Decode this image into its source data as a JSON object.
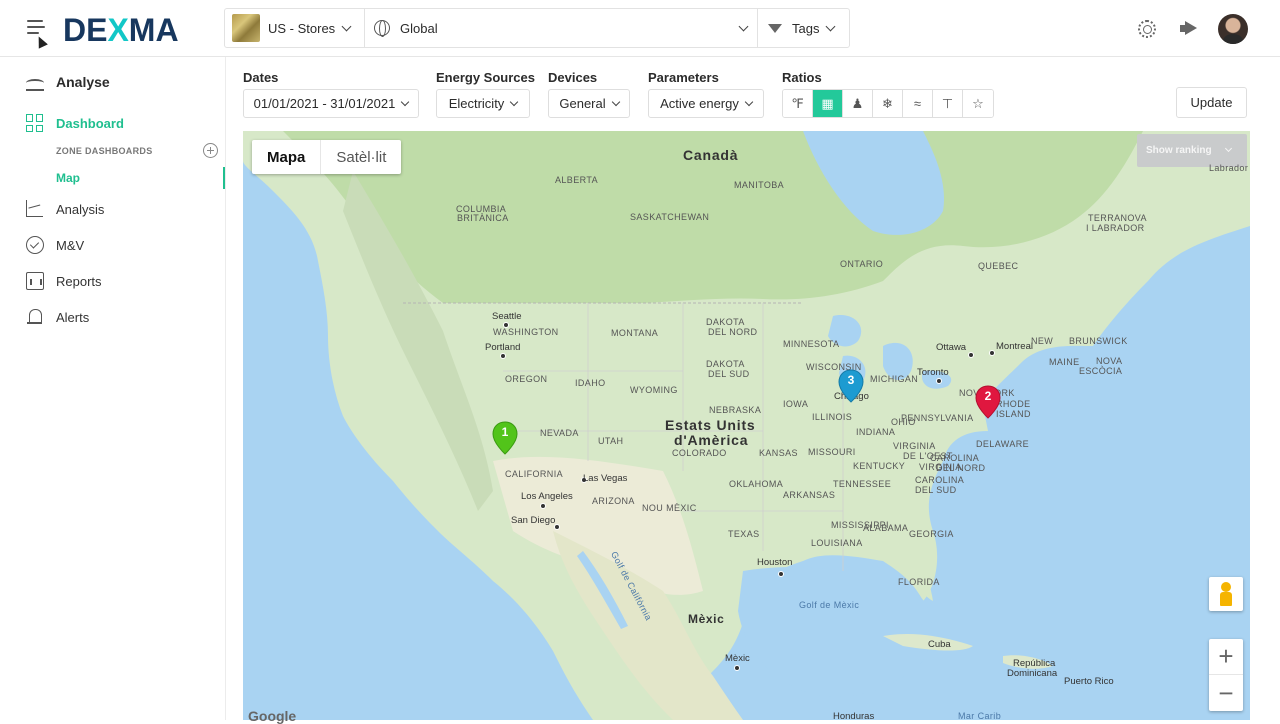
{
  "header": {
    "logo": {
      "prefix": "DE",
      "x": "X",
      "suffix": "MA"
    },
    "store_selector": "US - Stores",
    "location_selector": "Global",
    "tags_selector": "Tags"
  },
  "sidebar": {
    "section": "Analyse",
    "dashboard": "Dashboard",
    "zone_dashboards": "ZONE DASHBOARDS",
    "map": "Map",
    "items": [
      "Analysis",
      "M&V",
      "Reports",
      "Alerts"
    ]
  },
  "filters": {
    "dates": {
      "label": "Dates",
      "value": "01/01/2021 - 31/01/2021"
    },
    "energy_sources": {
      "label": "Energy Sources",
      "value": "Electricity"
    },
    "devices": {
      "label": "Devices",
      "value": "General"
    },
    "parameters": {
      "label": "Parameters",
      "value": "Active energy"
    },
    "ratios": {
      "label": "Ratios",
      "buttons": [
        "thermo-degree-icon",
        "grid-icon",
        "people-icon",
        "cold-thermo-icon",
        "thermo-wave-icon",
        "cup-icon",
        "star-icon"
      ],
      "active_index": 1
    },
    "update": "Update"
  },
  "map": {
    "type_buttons": [
      "Mapa",
      "Satèl·lit"
    ],
    "show_ranking": "Show ranking",
    "attribution": "Google",
    "countries": [
      "Canadà",
      "Estats Units",
      "d'Amèrica",
      "Mèxic"
    ],
    "region_labels": [
      "ALBERTA",
      "MANITOBA",
      "SASKATCHEWAN",
      "COLUMBIA",
      "BRITÀNICA",
      "ONTARIO",
      "QUEBEC",
      "TERRANOVA",
      "I LABRADOR",
      "Labrador",
      "WASHINGTON",
      "MONTANA",
      "DAKOTA",
      "DEL NORD",
      "MINNESOTA",
      "DAKOTA",
      "DEL SUD",
      "OREGON",
      "IDAHO",
      "WYOMING",
      "WISCONSIN",
      "MICHIGAN",
      "NEBRASKA",
      "IOWA",
      "NEVADA",
      "UTAH",
      "COLORADO",
      "KANSAS",
      "ILLINOIS",
      "INDIANA",
      "OHIO",
      "MISSOURI",
      "KENTUCKY",
      "CALIFORNIA",
      "ARIZONA",
      "NOU MÈXIC",
      "OKLAHOMA",
      "TENNESSEE",
      "ARKANSAS",
      "TEXAS",
      "LOUISIANA",
      "FLORIDA",
      "GEORGIA",
      "ALABAMA",
      "CAROLINA",
      "DEL SUD",
      "CAROLINA",
      "DEL NORD",
      "VIRGINIA",
      "VIRGINIA",
      "DE L'OEST",
      "PENNSYLVANIA",
      "NOVA YORK",
      "RHODE",
      "ISLAND",
      "DELAWARE",
      "MAINE",
      "NOVA",
      "ESCÒCIA",
      "NEW",
      "BRUNSWICK",
      "MISSISSIPPI"
    ],
    "cities": [
      "Seattle",
      "Portland",
      "Las Vegas",
      "Los Angeles",
      "San Diego",
      "Chicago",
      "Toronto",
      "Ottawa",
      "Montreal",
      "Houston",
      "Cuba",
      "Mèxic",
      "República",
      "Dominicana",
      "Puerto Rico",
      "Honduras",
      "Mar Carib"
    ],
    "seas": [
      "Golf de Mèxic",
      "Golf de Califòrnia"
    ],
    "markers": [
      {
        "label": "1",
        "color": "#52c41a"
      },
      {
        "label": "2",
        "color": "#e0173f"
      },
      {
        "label": "3",
        "color": "#1d9bd1"
      }
    ]
  },
  "colors": {
    "accent": "#1fbf8f",
    "logo": "#17375e",
    "logo_x": "#12c7c7"
  }
}
